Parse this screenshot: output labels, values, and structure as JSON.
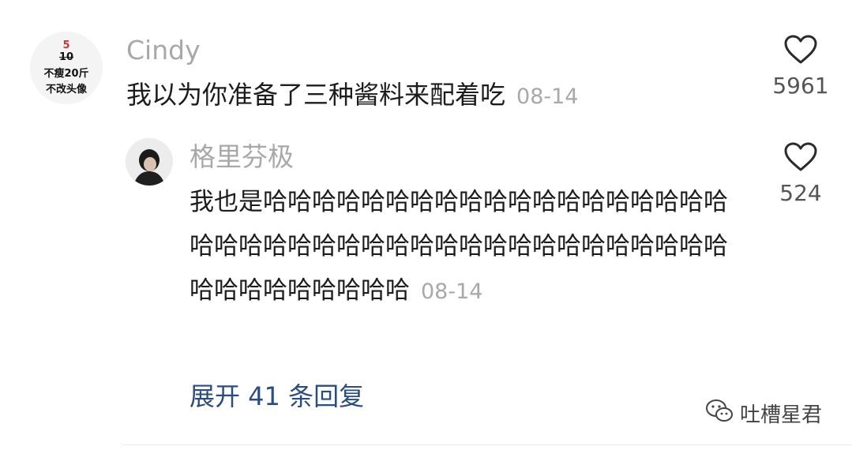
{
  "main_comment": {
    "avatar": {
      "line1": "5",
      "line2_struck": "10",
      "line3": "不瘦20斤",
      "line4": "不改头像"
    },
    "username": "Cindy",
    "text": "我以为你准备了三种酱料来配着吃",
    "date": "08-14",
    "likes": "5961"
  },
  "reply": {
    "username": "格里芬极",
    "text": "我也是哈哈哈哈哈哈哈哈哈哈哈哈哈哈哈哈哈哈哈哈哈哈哈哈哈哈哈哈哈哈哈哈哈哈哈哈哈哈哈哈哈哈哈哈哈哈哈哈哈哈",
    "date": "08-14",
    "likes": "524"
  },
  "expand_replies": "展开 41 条回复",
  "watermark": "吐槽星君",
  "icons": {
    "like": "heart-outline-icon",
    "watermark": "wechat-icon"
  }
}
